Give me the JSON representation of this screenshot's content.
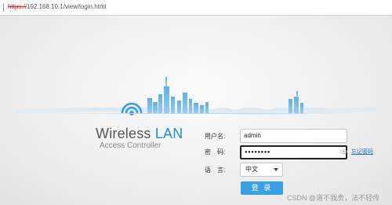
{
  "browser": {
    "url_scheme": "https://",
    "url_rest": "192.168.10.1/view/login.html"
  },
  "brand": {
    "title_main": "Wireless ",
    "title_accent": "LAN",
    "subtitle": "Access Controller"
  },
  "form": {
    "username_label": "用户名:",
    "username_value": "admin",
    "password_label": "密　码:",
    "password_masked": "●●●●●●●●",
    "forgot_link": "忘记密码",
    "language_label": "语　言:",
    "language_value": "中文",
    "login_button": "登 录"
  },
  "watermark": "CSDN @道不我贵，法不轻传",
  "colors": {
    "accent": "#1a8fd8",
    "button": "#3aa0e6",
    "skyline": "#6fb4e0"
  },
  "icons": {
    "wifi": "wifi-icon",
    "eye": "eye-icon",
    "dropdown": "chevron-down-icon"
  }
}
